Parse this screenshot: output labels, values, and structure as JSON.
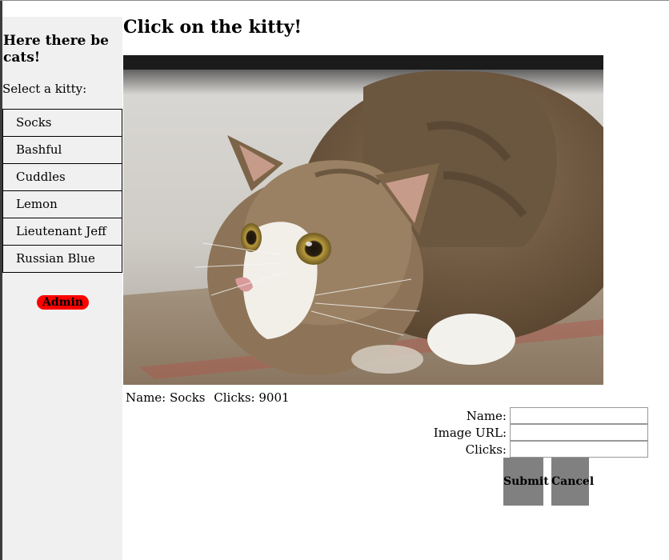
{
  "sidebar": {
    "heading": "Here there be cats!",
    "prompt": "Select a kitty:",
    "kitties": [
      "Socks",
      "Bashful",
      "Cuddles",
      "Lemon",
      "Lieutenant Jeff",
      "Russian Blue"
    ],
    "admin_label": "Admin"
  },
  "main": {
    "title": "Click on the kitty!",
    "image_icon": "tabby-cat-photo",
    "name_text": "Name: Socks",
    "clicks_text": "Clicks: 9001"
  },
  "admin_form": {
    "name_label": "Name:",
    "name_value": "",
    "url_label": "Image URL:",
    "url_value": "",
    "clicks_label": "Clicks:",
    "clicks_value": "",
    "submit_label": "Submit",
    "cancel_label": "Cancel"
  },
  "colors": {
    "sidebar_bg": "#f0f0f0",
    "admin_button": "#ff0000",
    "form_buttons": "#808080"
  }
}
